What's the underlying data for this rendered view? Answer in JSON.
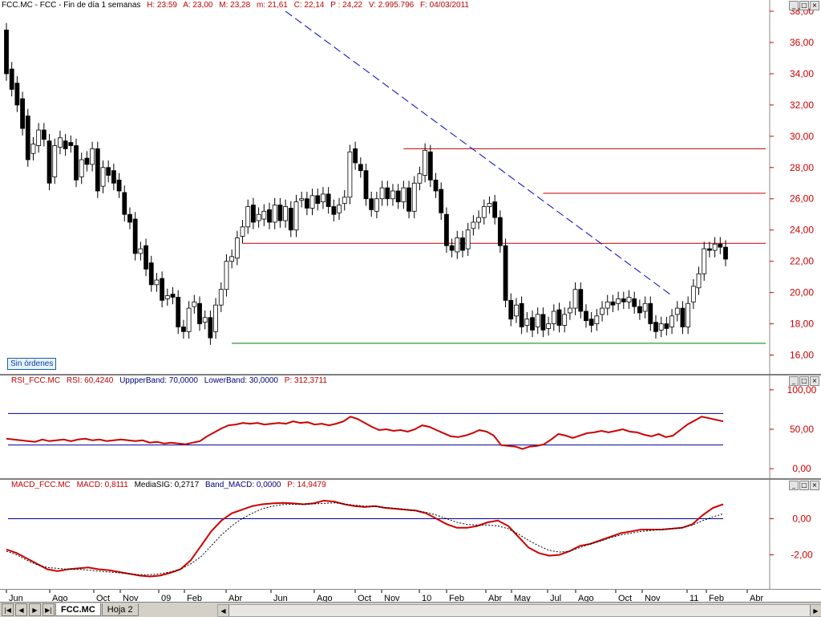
{
  "price_panel": {
    "header": {
      "symbol": "FCC.MC - FCC - Fin de día 1 semanas",
      "h": "H: 23:59",
      "a": "A: 23,00",
      "m": "M: 23,28",
      "min": "m: 21,61",
      "c": "C: 22,14",
      "p": "P : 24,22",
      "v": "V: 2.995.796",
      "f": "F: 04/03/2011"
    },
    "badge": "Sin órdenes"
  },
  "rsi_panel": {
    "header": {
      "name": "RSI_FCC.MC",
      "rsi": "RSI: 60,4240",
      "upper": "UppperBand: 70,0000",
      "lower": "LowerBand: 30,0000",
      "p": "P: 312,3711"
    }
  },
  "macd_panel": {
    "header": {
      "name": "MACD_FCC.MC",
      "macd": "MACD: 0,8111",
      "signal": "MediaSIG: 0,2717",
      "band": "Band_MACD: 0,0000",
      "p": "P: 14,9479"
    }
  },
  "window_buttons": {
    "min": "_",
    "max": "□",
    "close": "×"
  },
  "time_axis": [
    "Jun",
    "Ago",
    "Oct",
    "Nov",
    "09",
    "Feb",
    "Abr",
    "Jun",
    "Ago",
    "Oct",
    "Nov",
    "10",
    "Feb",
    "Abr",
    "May",
    "Jul",
    "Ago",
    "Oct",
    "Nov",
    "11",
    "Feb",
    "Abr"
  ],
  "tabs": {
    "active": "FCC.MC",
    "other": "Hoja 2"
  },
  "nav_icons": [
    "first-icon",
    "prev-icon",
    "next-icon",
    "last-icon"
  ],
  "colors": {
    "price_line": "#c00000",
    "support_line": "#008000",
    "trend_line": "#0000cc",
    "rsi_line": "#cc0000",
    "band_line": "#000099",
    "axis_text": "#cc0000"
  },
  "chart_data": [
    {
      "type": "candlestick",
      "name": "FCC.MC weekly",
      "ylim": [
        15,
        38
      ],
      "yticks": [
        "16,00",
        "18,00",
        "20,00",
        "22,00",
        "24,00",
        "26,00",
        "28,00",
        "30,00",
        "32,00",
        "34,00",
        "36,00",
        "38,00"
      ],
      "ytick_values": [
        16,
        18,
        20,
        22,
        24,
        26,
        28,
        30,
        32,
        34,
        36,
        38
      ],
      "candles": [
        [
          36.8,
          34.0
        ],
        [
          34.3,
          33.0
        ],
        [
          33.4,
          32.0
        ],
        [
          32.4,
          30.5
        ],
        [
          31.3,
          28.5
        ],
        [
          28.9,
          29.5
        ],
        [
          29.4,
          30.4
        ],
        [
          30.4,
          29.8
        ],
        [
          29.7,
          27.0
        ],
        [
          27.4,
          29.4
        ],
        [
          29.3,
          29.9
        ],
        [
          29.7,
          29.2
        ],
        [
          29.6,
          29.4
        ],
        [
          29.4,
          27.2
        ],
        [
          27.4,
          28.5
        ],
        [
          28.6,
          28.2
        ],
        [
          28.2,
          29.2
        ],
        [
          29.2,
          26.5
        ],
        [
          26.8,
          28.0
        ],
        [
          28.0,
          27.5
        ],
        [
          27.8,
          27.0
        ],
        [
          27.2,
          26.5
        ],
        [
          26.4,
          25.0
        ],
        [
          25.0,
          24.5
        ],
        [
          24.7,
          22.5
        ],
        [
          22.5,
          22.8
        ],
        [
          23.0,
          21.5
        ],
        [
          21.9,
          20.5
        ],
        [
          20.5,
          20.8
        ],
        [
          20.9,
          19.5
        ],
        [
          19.6,
          19.8
        ],
        [
          19.9,
          19.7
        ],
        [
          19.7,
          17.8
        ],
        [
          17.8,
          17.5
        ],
        [
          17.5,
          19.0
        ],
        [
          19.1,
          19.4
        ],
        [
          19.3,
          18.0
        ],
        [
          18.1,
          18.4
        ],
        [
          18.4,
          17.1
        ],
        [
          17.5,
          19.2
        ],
        [
          19.2,
          20.2
        ],
        [
          20.2,
          22.0
        ],
        [
          22.0,
          22.3
        ],
        [
          22.2,
          23.5
        ],
        [
          23.6,
          24.2
        ],
        [
          24.2,
          25.5
        ],
        [
          25.6,
          24.5
        ],
        [
          24.6,
          25.0
        ],
        [
          24.7,
          25.2
        ],
        [
          25.3,
          24.5
        ],
        [
          24.5,
          25.6
        ],
        [
          25.6,
          24.6
        ],
        [
          24.6,
          25.5
        ],
        [
          25.4,
          24.0
        ],
        [
          24.0,
          25.8
        ],
        [
          25.9,
          26.0
        ],
        [
          26.0,
          25.4
        ],
        [
          25.4,
          26.2
        ],
        [
          26.2,
          25.7
        ],
        [
          25.8,
          26.3
        ],
        [
          26.3,
          25.5
        ],
        [
          25.5,
          25.0
        ],
        [
          25.1,
          25.6
        ],
        [
          25.7,
          26.1
        ],
        [
          26.1,
          29.0
        ],
        [
          29.2,
          28.3
        ],
        [
          28.2,
          27.8
        ],
        [
          27.8,
          26.0
        ],
        [
          26.0,
          25.3
        ],
        [
          25.2,
          26.0
        ],
        [
          26.0,
          26.7
        ],
        [
          26.7,
          26.0
        ],
        [
          26.0,
          26.5
        ],
        [
          26.5,
          25.8
        ],
        [
          25.8,
          26.7
        ],
        [
          26.7,
          25.2
        ],
        [
          25.2,
          27.0
        ],
        [
          27.0,
          27.6
        ],
        [
          27.5,
          29.1
        ],
        [
          29.0,
          27.2
        ],
        [
          27.2,
          26.5
        ],
        [
          26.6,
          25.1
        ],
        [
          25.0,
          23.0
        ],
        [
          23.0,
          22.7
        ],
        [
          22.6,
          23.5
        ],
        [
          23.5,
          22.7
        ],
        [
          22.8,
          24.0
        ],
        [
          24.1,
          24.5
        ],
        [
          24.5,
          24.8
        ],
        [
          24.8,
          25.5
        ],
        [
          25.5,
          25.7
        ],
        [
          25.8,
          24.8
        ],
        [
          24.8,
          23.0
        ],
        [
          23.0,
          19.5
        ],
        [
          19.5,
          18.3
        ],
        [
          18.5,
          19.2
        ],
        [
          19.3,
          17.8
        ],
        [
          17.9,
          18.3
        ],
        [
          18.4,
          17.6
        ],
        [
          17.8,
          18.6
        ],
        [
          18.6,
          17.6
        ],
        [
          17.7,
          18.0
        ],
        [
          18.0,
          18.8
        ],
        [
          18.9,
          17.9
        ],
        [
          17.9,
          18.6
        ],
        [
          18.7,
          19.0
        ],
        [
          19.0,
          20.2
        ],
        [
          20.2,
          18.8
        ],
        [
          18.8,
          18.2
        ],
        [
          18.3,
          17.9
        ],
        [
          18.0,
          18.5
        ],
        [
          18.6,
          19.0
        ],
        [
          19.0,
          19.4
        ],
        [
          19.4,
          19.2
        ],
        [
          19.3,
          19.6
        ],
        [
          19.6,
          19.4
        ],
        [
          19.4,
          19.7
        ],
        [
          19.6,
          19.1
        ],
        [
          19.1,
          18.7
        ],
        [
          18.8,
          19.3
        ],
        [
          19.3,
          18.0
        ],
        [
          18.1,
          17.5
        ],
        [
          17.6,
          18.0
        ],
        [
          18.0,
          17.7
        ],
        [
          17.8,
          18.5
        ],
        [
          18.6,
          19.0
        ],
        [
          19.0,
          17.8
        ],
        [
          17.8,
          19.3
        ],
        [
          19.4,
          20.4
        ],
        [
          20.3,
          21.2
        ],
        [
          21.2,
          22.8
        ],
        [
          22.8,
          22.7
        ],
        [
          22.7,
          23.1
        ],
        [
          23.1,
          22.9
        ],
        [
          22.9,
          22.14
        ]
      ],
      "hlines": [
        {
          "value": 29.2,
          "color": "#c00000",
          "from_candle": 74
        },
        {
          "value": 26.35,
          "color": "#c00000",
          "from_candle": 100
        },
        {
          "value": 23.15,
          "color": "#c00000",
          "from_candle": 44
        },
        {
          "value": 16.75,
          "color": "#008000",
          "from_candle": 42
        }
      ],
      "trendline": {
        "from": [
          52,
          38.0
        ],
        "to": [
          124,
          19.8
        ],
        "color": "#0000cc"
      }
    },
    {
      "type": "line",
      "name": "RSI",
      "ylim": [
        -10,
        110
      ],
      "yticks": [
        "0,00",
        "50,00",
        "100,00"
      ],
      "ytick_values": [
        0,
        50,
        100
      ],
      "bands": [
        70,
        30
      ],
      "values": [
        38,
        37,
        36,
        35,
        34,
        37,
        35,
        36,
        37,
        35,
        37,
        38,
        36,
        37,
        35,
        36,
        37,
        36,
        35,
        36,
        33,
        34,
        32,
        33,
        32,
        31,
        33,
        35,
        41,
        46,
        51,
        55,
        56,
        58,
        57,
        58,
        56,
        57,
        58,
        57,
        60,
        58,
        59,
        56,
        57,
        55,
        57,
        60,
        66,
        63,
        58,
        53,
        49,
        50,
        48,
        49,
        47,
        50,
        55,
        53,
        49,
        45,
        41,
        40,
        42,
        45,
        49,
        47,
        42,
        30,
        29,
        28,
        25,
        28,
        29,
        31,
        37,
        44,
        42,
        39,
        42,
        45,
        46,
        48,
        46,
        48,
        50,
        47,
        46,
        43,
        41,
        44,
        40,
        42,
        49,
        56,
        61,
        66,
        64,
        62,
        60
      ]
    },
    {
      "type": "line",
      "name": "MACD",
      "ylim": [
        -3.8,
        1.8
      ],
      "yticks": [
        "-2,00",
        "0,00"
      ],
      "ytick_values": [
        -2,
        0
      ],
      "zero_line": 0,
      "series": [
        {
          "values": [
            -1.7,
            -1.9,
            -2.2,
            -2.5,
            -2.8,
            -2.9,
            -2.8,
            -2.75,
            -2.7,
            -2.8,
            -2.85,
            -2.95,
            -3.05,
            -3.15,
            -3.2,
            -3.15,
            -3.0,
            -2.8,
            -2.3,
            -1.5,
            -0.7,
            -0.1,
            0.3,
            0.5,
            0.7,
            0.8,
            0.85,
            0.88,
            0.85,
            0.8,
            0.85,
            1.0,
            0.95,
            0.8,
            0.7,
            0.65,
            0.7,
            0.6,
            0.55,
            0.5,
            0.45,
            0.3,
            0.0,
            -0.3,
            -0.5,
            -0.5,
            -0.4,
            -0.2,
            -0.1,
            -0.4,
            -1.0,
            -1.6,
            -1.9,
            -2.05,
            -2.0,
            -1.8,
            -1.5,
            -1.4,
            -1.2,
            -1.0,
            -0.8,
            -0.7,
            -0.6,
            -0.6,
            -0.6,
            -0.55,
            -0.5,
            -0.3,
            0.2,
            0.6,
            0.8
          ]
        },
        {
          "values": [
            -1.8,
            -2.0,
            -2.3,
            -2.55,
            -2.7,
            -2.75,
            -2.8,
            -2.8,
            -2.85,
            -2.9,
            -2.95,
            -3.0,
            -3.05,
            -3.1,
            -3.1,
            -3.05,
            -2.95,
            -2.8,
            -2.5,
            -2.1,
            -1.5,
            -0.9,
            -0.4,
            0.0,
            0.3,
            0.55,
            0.7,
            0.78,
            0.8,
            0.8,
            0.82,
            0.85,
            0.88,
            0.82,
            0.75,
            0.7,
            0.68,
            0.62,
            0.58,
            0.52,
            0.45,
            0.35,
            0.2,
            0.0,
            -0.2,
            -0.32,
            -0.35,
            -0.35,
            -0.4,
            -0.55,
            -0.85,
            -1.2,
            -1.5,
            -1.75,
            -1.85,
            -1.8,
            -1.6,
            -1.4,
            -1.25,
            -1.05,
            -0.9,
            -0.8,
            -0.7,
            -0.65,
            -0.6,
            -0.55,
            -0.5,
            -0.35,
            -0.1,
            0.1,
            0.27
          ]
        }
      ]
    }
  ]
}
